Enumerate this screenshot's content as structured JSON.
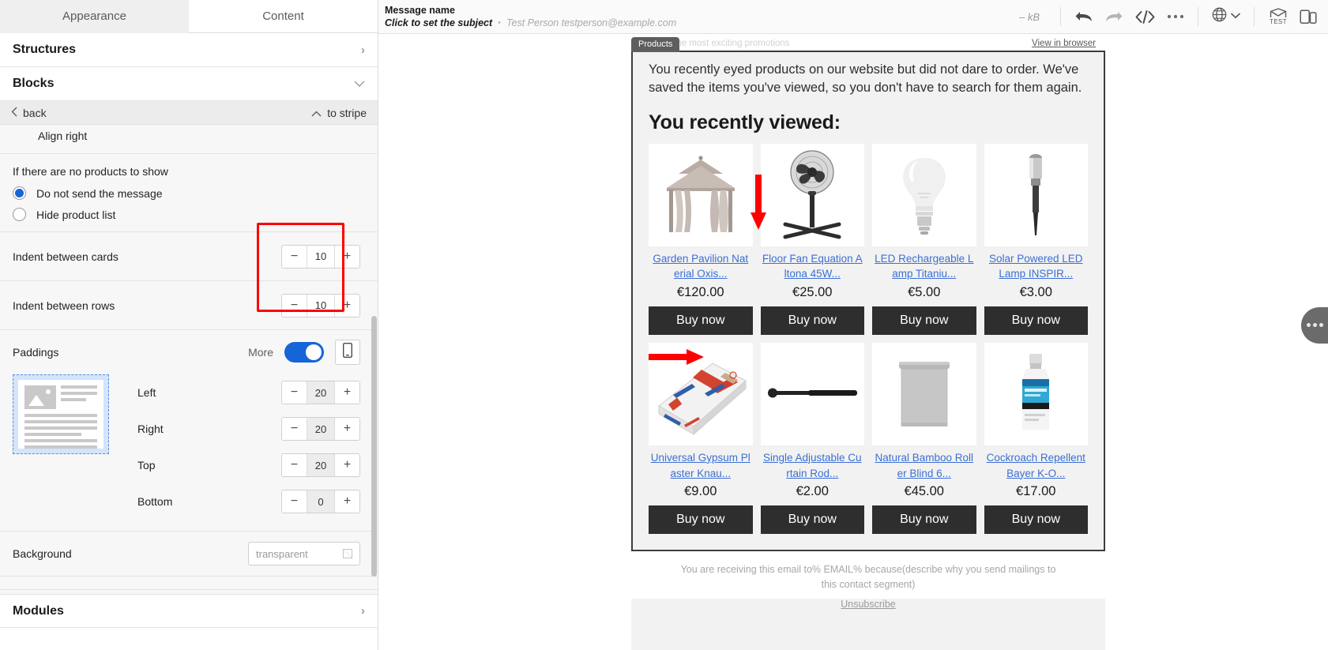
{
  "sidebar": {
    "tabs": [
      {
        "label": "Appearance",
        "active": true
      },
      {
        "label": "Content",
        "active": false
      }
    ],
    "sections": [
      {
        "label": "Structures"
      },
      {
        "label": "Blocks"
      },
      {
        "label": "Modules"
      }
    ],
    "backbar": {
      "back_label": "back",
      "to_stripe_label": "to stripe"
    },
    "align_right_label": "Align right",
    "no_products": {
      "group_label": "If there are no products to show",
      "options": [
        {
          "label": "Do not send the message",
          "selected": true
        },
        {
          "label": "Hide product list",
          "selected": false
        }
      ]
    },
    "indents": [
      {
        "label": "Indent between cards",
        "value": "10"
      },
      {
        "label": "Indent between rows",
        "value": "10"
      }
    ],
    "paddings": {
      "title": "Paddings",
      "more_label": "More",
      "toggle_on": true,
      "fields": [
        {
          "label": "Left",
          "value": "20"
        },
        {
          "label": "Right",
          "value": "20"
        },
        {
          "label": "Top",
          "value": "20"
        },
        {
          "label": "Bottom",
          "value": "0"
        }
      ]
    },
    "background": {
      "label": "Background",
      "value": "transparent"
    },
    "minus": "−",
    "plus": "+",
    "chev_right": "›",
    "chev_down": "⌄",
    "chev_up": "⌃",
    "chev_left": "‹"
  },
  "topbar": {
    "message_name": "Message name",
    "subject_placeholder": "Click to set the subject",
    "sender": "Test Person testperson@example.com",
    "separator": "•",
    "size": "– kB",
    "icons": [
      "undo-icon",
      "redo-icon",
      "code-icon",
      "more-icon",
      "language-icon",
      "test-send-icon",
      "device-preview-icon"
    ],
    "test_label": "TEST"
  },
  "email": {
    "preheader": "...der of the most exciting promotions",
    "view_in_browser": "View in browser",
    "block_tag": "Products",
    "intro": "You recently eyed products on our website but did not dare to order. We've saved the items you've viewed, so you don't have to search for them again.",
    "heading": "You recently viewed:",
    "buy_label": "Buy now",
    "products": [
      {
        "name": "Garden Pavilion Nat erial Oxis...",
        "price": "€120.00",
        "image": "garden-pavilion"
      },
      {
        "name": "Floor Fan Equation A ltona 45W...",
        "price": "€25.00",
        "image": "floor-fan"
      },
      {
        "name": "LED Rechargeable L amp Titaniu...",
        "price": "€5.00",
        "image": "led-bulb"
      },
      {
        "name": "Solar Powered LED Lamp INSPIR...",
        "price": "€3.00",
        "image": "solar-lamp"
      },
      {
        "name": "Universal Gypsum Pl aster Knau...",
        "price": "€9.00",
        "image": "gypsum-bag"
      },
      {
        "name": "Single Adjustable Cu rtain Rod...",
        "price": "€2.00",
        "image": "curtain-rod"
      },
      {
        "name": "Natural Bamboo Roll er Blind 6...",
        "price": "€45.00",
        "image": "roller-blind"
      },
      {
        "name": "Cockroach Repellent Bayer K-O...",
        "price": "€17.00",
        "image": "repellent-bottle"
      }
    ],
    "footer_text": "You are receiving this email to% EMAIL% because(describe why you send mailings to this contact segment)",
    "footer_link": "Unsubscribe"
  },
  "colors": {
    "accent": "#1565d8",
    "annotation_red": "#ff0000",
    "link_blue": "#3b6fd4",
    "button_dark": "#2e2e2e"
  }
}
